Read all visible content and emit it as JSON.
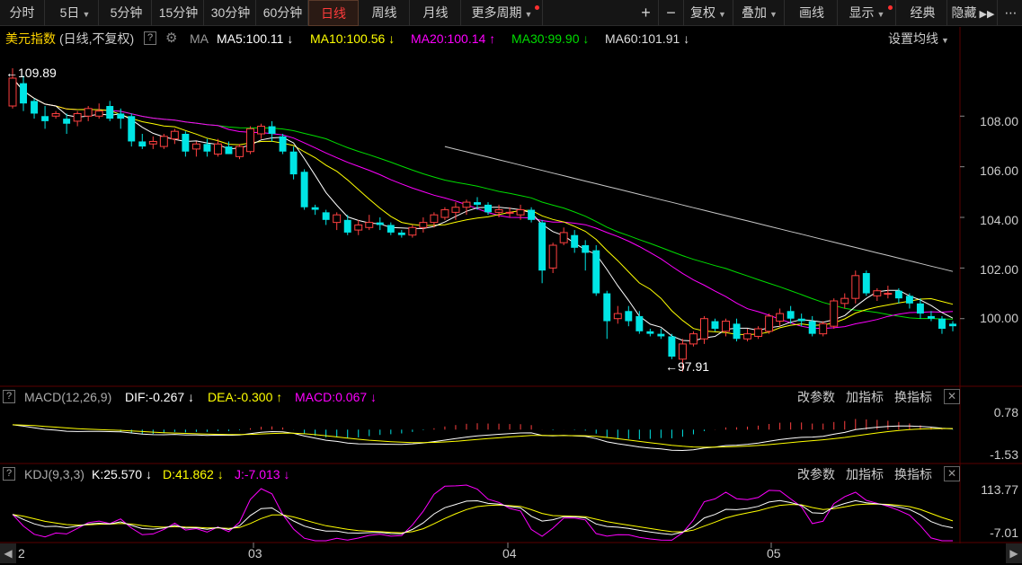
{
  "toolbar": {
    "left": [
      "分时",
      "5日",
      "5分钟",
      "15分钟",
      "30分钟",
      "60分钟",
      "日线",
      "周线",
      "月线",
      "更多周期"
    ],
    "active": "日线",
    "right": [
      "复权",
      "叠加",
      "画线",
      "显示",
      "经典",
      "隐藏"
    ],
    "plus": "+",
    "minus": "−"
  },
  "info": {
    "title": "美元指数",
    "subtitle": "(日线,不复权)",
    "ma_label": "MA",
    "ma5": "MA5:100.11",
    "ma10": "MA10:100.56",
    "ma20": "MA20:100.14",
    "ma30": "MA30:99.90",
    "ma60": "MA60:101.91",
    "arrow_down": "↓",
    "arrow_up": "↑",
    "settings": "设置均线"
  },
  "price_axis": [
    "108.00",
    "106.00",
    "104.00",
    "102.00",
    "100.00"
  ],
  "annotations": {
    "high": "109.89",
    "low": "97.91"
  },
  "macd": {
    "name": "MACD(12,26,9)",
    "dif": "DIF:-0.267",
    "dea": "DEA:-0.300",
    "macd": "MACD:0.067",
    "axis_top": "0.78",
    "axis_bottom": "-1.53"
  },
  "kdj": {
    "name": "KDJ(9,3,3)",
    "k": "K:25.570",
    "d": "D:41.862",
    "j": "J:-7.013",
    "axis_top": "113.77",
    "axis_bottom": "-7.01"
  },
  "panel_actions": [
    "改参数",
    "加指标",
    "换指标"
  ],
  "x_axis": [
    "2",
    "03",
    "04",
    "05"
  ],
  "colors": {
    "up": "#ff4040",
    "down": "#00e5e5",
    "ma5": "#ffffff",
    "ma10": "#ffff00",
    "ma20": "#ff00ff",
    "ma30": "#00dd00",
    "ma60": "#c8c8c8",
    "grid": "#3a0000"
  },
  "chart_data": {
    "type": "candlestick",
    "title": "美元指数",
    "ylim": [
      97.4,
      110.6
    ],
    "candles": [
      [
        108.4,
        109.89,
        108.3,
        109.5
      ],
      [
        109.3,
        109.6,
        108.2,
        108.5
      ],
      [
        108.6,
        108.7,
        107.9,
        108.1
      ],
      [
        108.0,
        108.4,
        107.5,
        107.8
      ],
      [
        108.0,
        108.2,
        107.9,
        108.1
      ],
      [
        107.9,
        108.1,
        107.3,
        107.7
      ],
      [
        107.8,
        108.2,
        107.6,
        108.1
      ],
      [
        108.0,
        108.4,
        107.8,
        108.3
      ],
      [
        108.0,
        108.5,
        107.9,
        108.2
      ],
      [
        108.4,
        108.6,
        107.8,
        107.9
      ],
      [
        108.1,
        108.3,
        107.5,
        107.9
      ],
      [
        108.0,
        108.1,
        106.8,
        107.0
      ],
      [
        107.0,
        107.3,
        106.7,
        106.8
      ],
      [
        106.9,
        107.2,
        106.7,
        107.0
      ],
      [
        106.8,
        107.3,
        106.7,
        107.2
      ],
      [
        107.1,
        107.5,
        106.9,
        107.4
      ],
      [
        107.3,
        107.4,
        106.4,
        106.6
      ],
      [
        106.7,
        107.0,
        106.4,
        106.9
      ],
      [
        106.9,
        107.1,
        106.4,
        106.6
      ],
      [
        106.5,
        107.1,
        106.4,
        106.9
      ],
      [
        106.8,
        107.0,
        106.5,
        106.5
      ],
      [
        106.4,
        106.9,
        106.3,
        106.8
      ],
      [
        106.6,
        107.6,
        106.5,
        107.5
      ],
      [
        107.3,
        107.7,
        107.1,
        107.6
      ],
      [
        107.6,
        107.8,
        107.0,
        107.3
      ],
      [
        107.2,
        107.3,
        106.5,
        106.6
      ],
      [
        106.6,
        106.8,
        105.5,
        105.7
      ],
      [
        105.8,
        105.9,
        104.3,
        104.4
      ],
      [
        104.4,
        104.5,
        104.1,
        104.3
      ],
      [
        104.2,
        104.3,
        103.7,
        103.9
      ],
      [
        103.8,
        104.2,
        103.5,
        104.1
      ],
      [
        103.9,
        104.1,
        103.3,
        103.4
      ],
      [
        103.5,
        103.9,
        103.3,
        103.7
      ],
      [
        103.6,
        104.1,
        103.5,
        103.8
      ],
      [
        103.8,
        104.0,
        103.5,
        103.7
      ],
      [
        103.7,
        103.8,
        103.3,
        103.4
      ],
      [
        103.4,
        103.5,
        103.2,
        103.3
      ],
      [
        103.3,
        103.7,
        103.2,
        103.6
      ],
      [
        103.6,
        104.0,
        103.4,
        103.8
      ],
      [
        103.8,
        104.2,
        103.6,
        104.1
      ],
      [
        104.0,
        104.4,
        103.9,
        104.3
      ],
      [
        104.2,
        104.6,
        103.9,
        104.4
      ],
      [
        104.4,
        104.7,
        104.1,
        104.6
      ],
      [
        104.6,
        104.8,
        104.3,
        104.5
      ],
      [
        104.5,
        104.6,
        104.1,
        104.2
      ],
      [
        104.2,
        104.5,
        104.0,
        104.3
      ],
      [
        104.2,
        104.4,
        104.0,
        104.2
      ],
      [
        104.1,
        104.5,
        103.9,
        104.3
      ],
      [
        104.3,
        104.4,
        103.8,
        103.9
      ],
      [
        103.8,
        103.9,
        101.4,
        101.9
      ],
      [
        102.0,
        103.0,
        101.8,
        102.9
      ],
      [
        103.0,
        103.6,
        102.9,
        103.4
      ],
      [
        103.3,
        103.5,
        102.6,
        102.8
      ],
      [
        102.9,
        103.1,
        101.9,
        102.6
      ],
      [
        102.7,
        102.9,
        100.9,
        101.0
      ],
      [
        101.0,
        101.1,
        99.2,
        99.9
      ],
      [
        100.0,
        100.5,
        99.8,
        100.2
      ],
      [
        100.3,
        100.5,
        99.7,
        99.9
      ],
      [
        100.1,
        100.3,
        99.4,
        99.5
      ],
      [
        99.5,
        99.6,
        99.3,
        99.4
      ],
      [
        99.4,
        99.6,
        99.2,
        99.3
      ],
      [
        99.3,
        99.4,
        98.4,
        98.5
      ],
      [
        98.4,
        99.2,
        97.91,
        99.0
      ],
      [
        99.0,
        99.5,
        98.9,
        99.4
      ],
      [
        99.2,
        100.1,
        99.0,
        100.0
      ],
      [
        99.9,
        100.0,
        99.5,
        99.6
      ],
      [
        99.5,
        100.0,
        99.3,
        99.9
      ],
      [
        99.8,
        100.0,
        99.1,
        99.2
      ],
      [
        99.2,
        99.6,
        99.1,
        99.4
      ],
      [
        99.3,
        99.7,
        99.2,
        99.6
      ],
      [
        99.5,
        100.2,
        99.4,
        100.1
      ],
      [
        99.9,
        100.4,
        99.7,
        100.2
      ],
      [
        100.3,
        100.5,
        99.8,
        100.0
      ],
      [
        100.0,
        100.2,
        99.7,
        99.9
      ],
      [
        99.9,
        100.1,
        99.3,
        99.4
      ],
      [
        99.4,
        99.9,
        99.3,
        99.8
      ],
      [
        99.7,
        100.8,
        99.6,
        100.7
      ],
      [
        100.6,
        101.0,
        100.4,
        100.8
      ],
      [
        100.8,
        101.9,
        100.6,
        101.7
      ],
      [
        101.8,
        101.9,
        100.9,
        101.0
      ],
      [
        100.9,
        101.2,
        100.7,
        101.1
      ],
      [
        101.0,
        101.3,
        100.8,
        101.0
      ],
      [
        101.1,
        101.2,
        100.6,
        100.8
      ],
      [
        100.9,
        101.0,
        100.4,
        100.6
      ],
      [
        100.6,
        100.8,
        100.0,
        100.2
      ],
      [
        100.1,
        100.3,
        99.9,
        100.0
      ],
      [
        100.0,
        100.1,
        99.4,
        99.6
      ],
      [
        99.8,
        99.9,
        99.5,
        99.7
      ]
    ]
  }
}
